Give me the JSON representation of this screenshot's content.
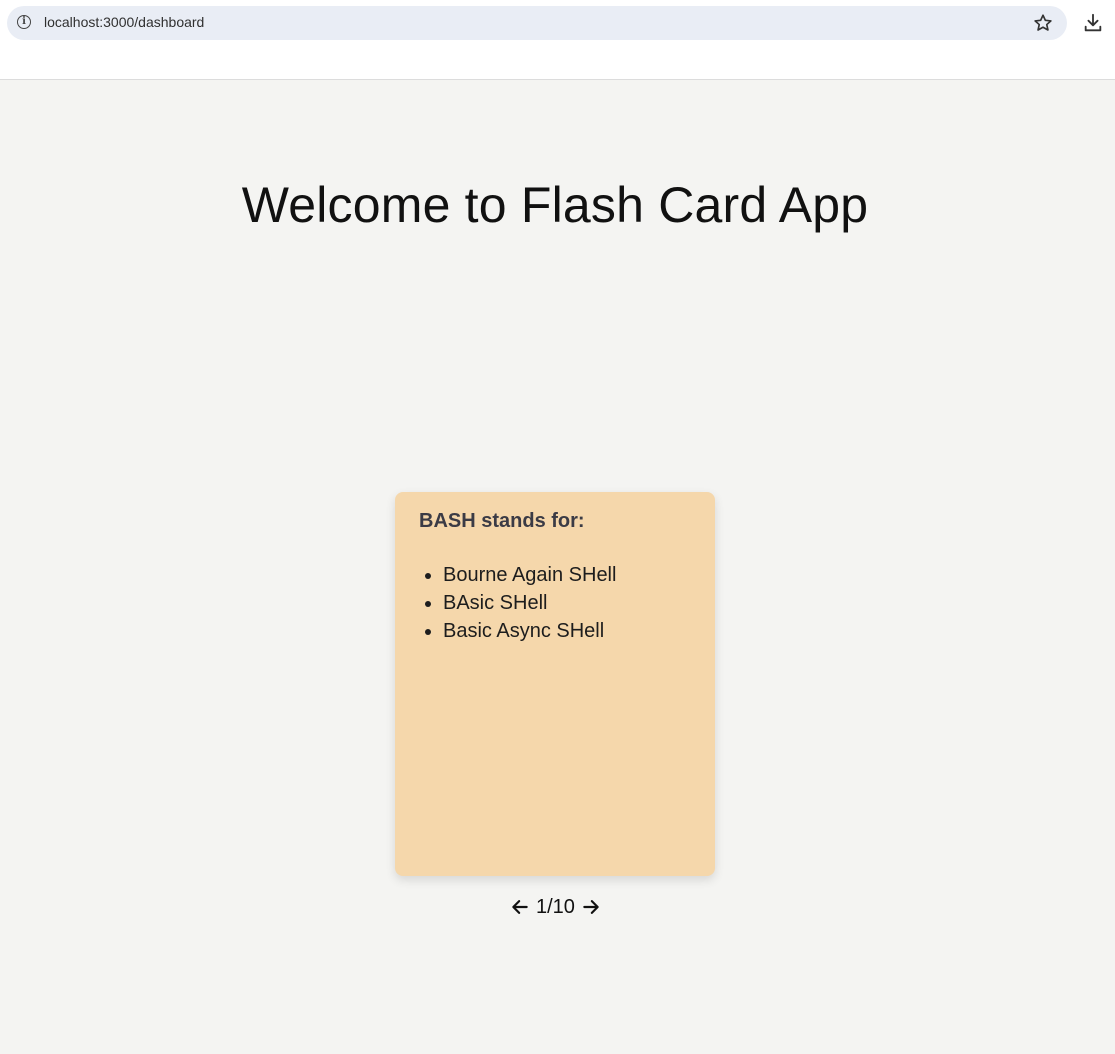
{
  "browser": {
    "url": "localhost:3000/dashboard"
  },
  "page": {
    "title": "Welcome to Flash Card App"
  },
  "card": {
    "question": "BASH stands for:",
    "options": [
      "Bourne Again SHell",
      "BAsic SHell",
      "Basic Async SHell"
    ],
    "background_color": "#f5d7ab"
  },
  "pager": {
    "current": "1/10"
  },
  "icons": {
    "info": "info-icon",
    "star": "star-icon",
    "download": "download-icon",
    "prev": "arrow-left-icon",
    "next": "arrow-right-icon"
  }
}
